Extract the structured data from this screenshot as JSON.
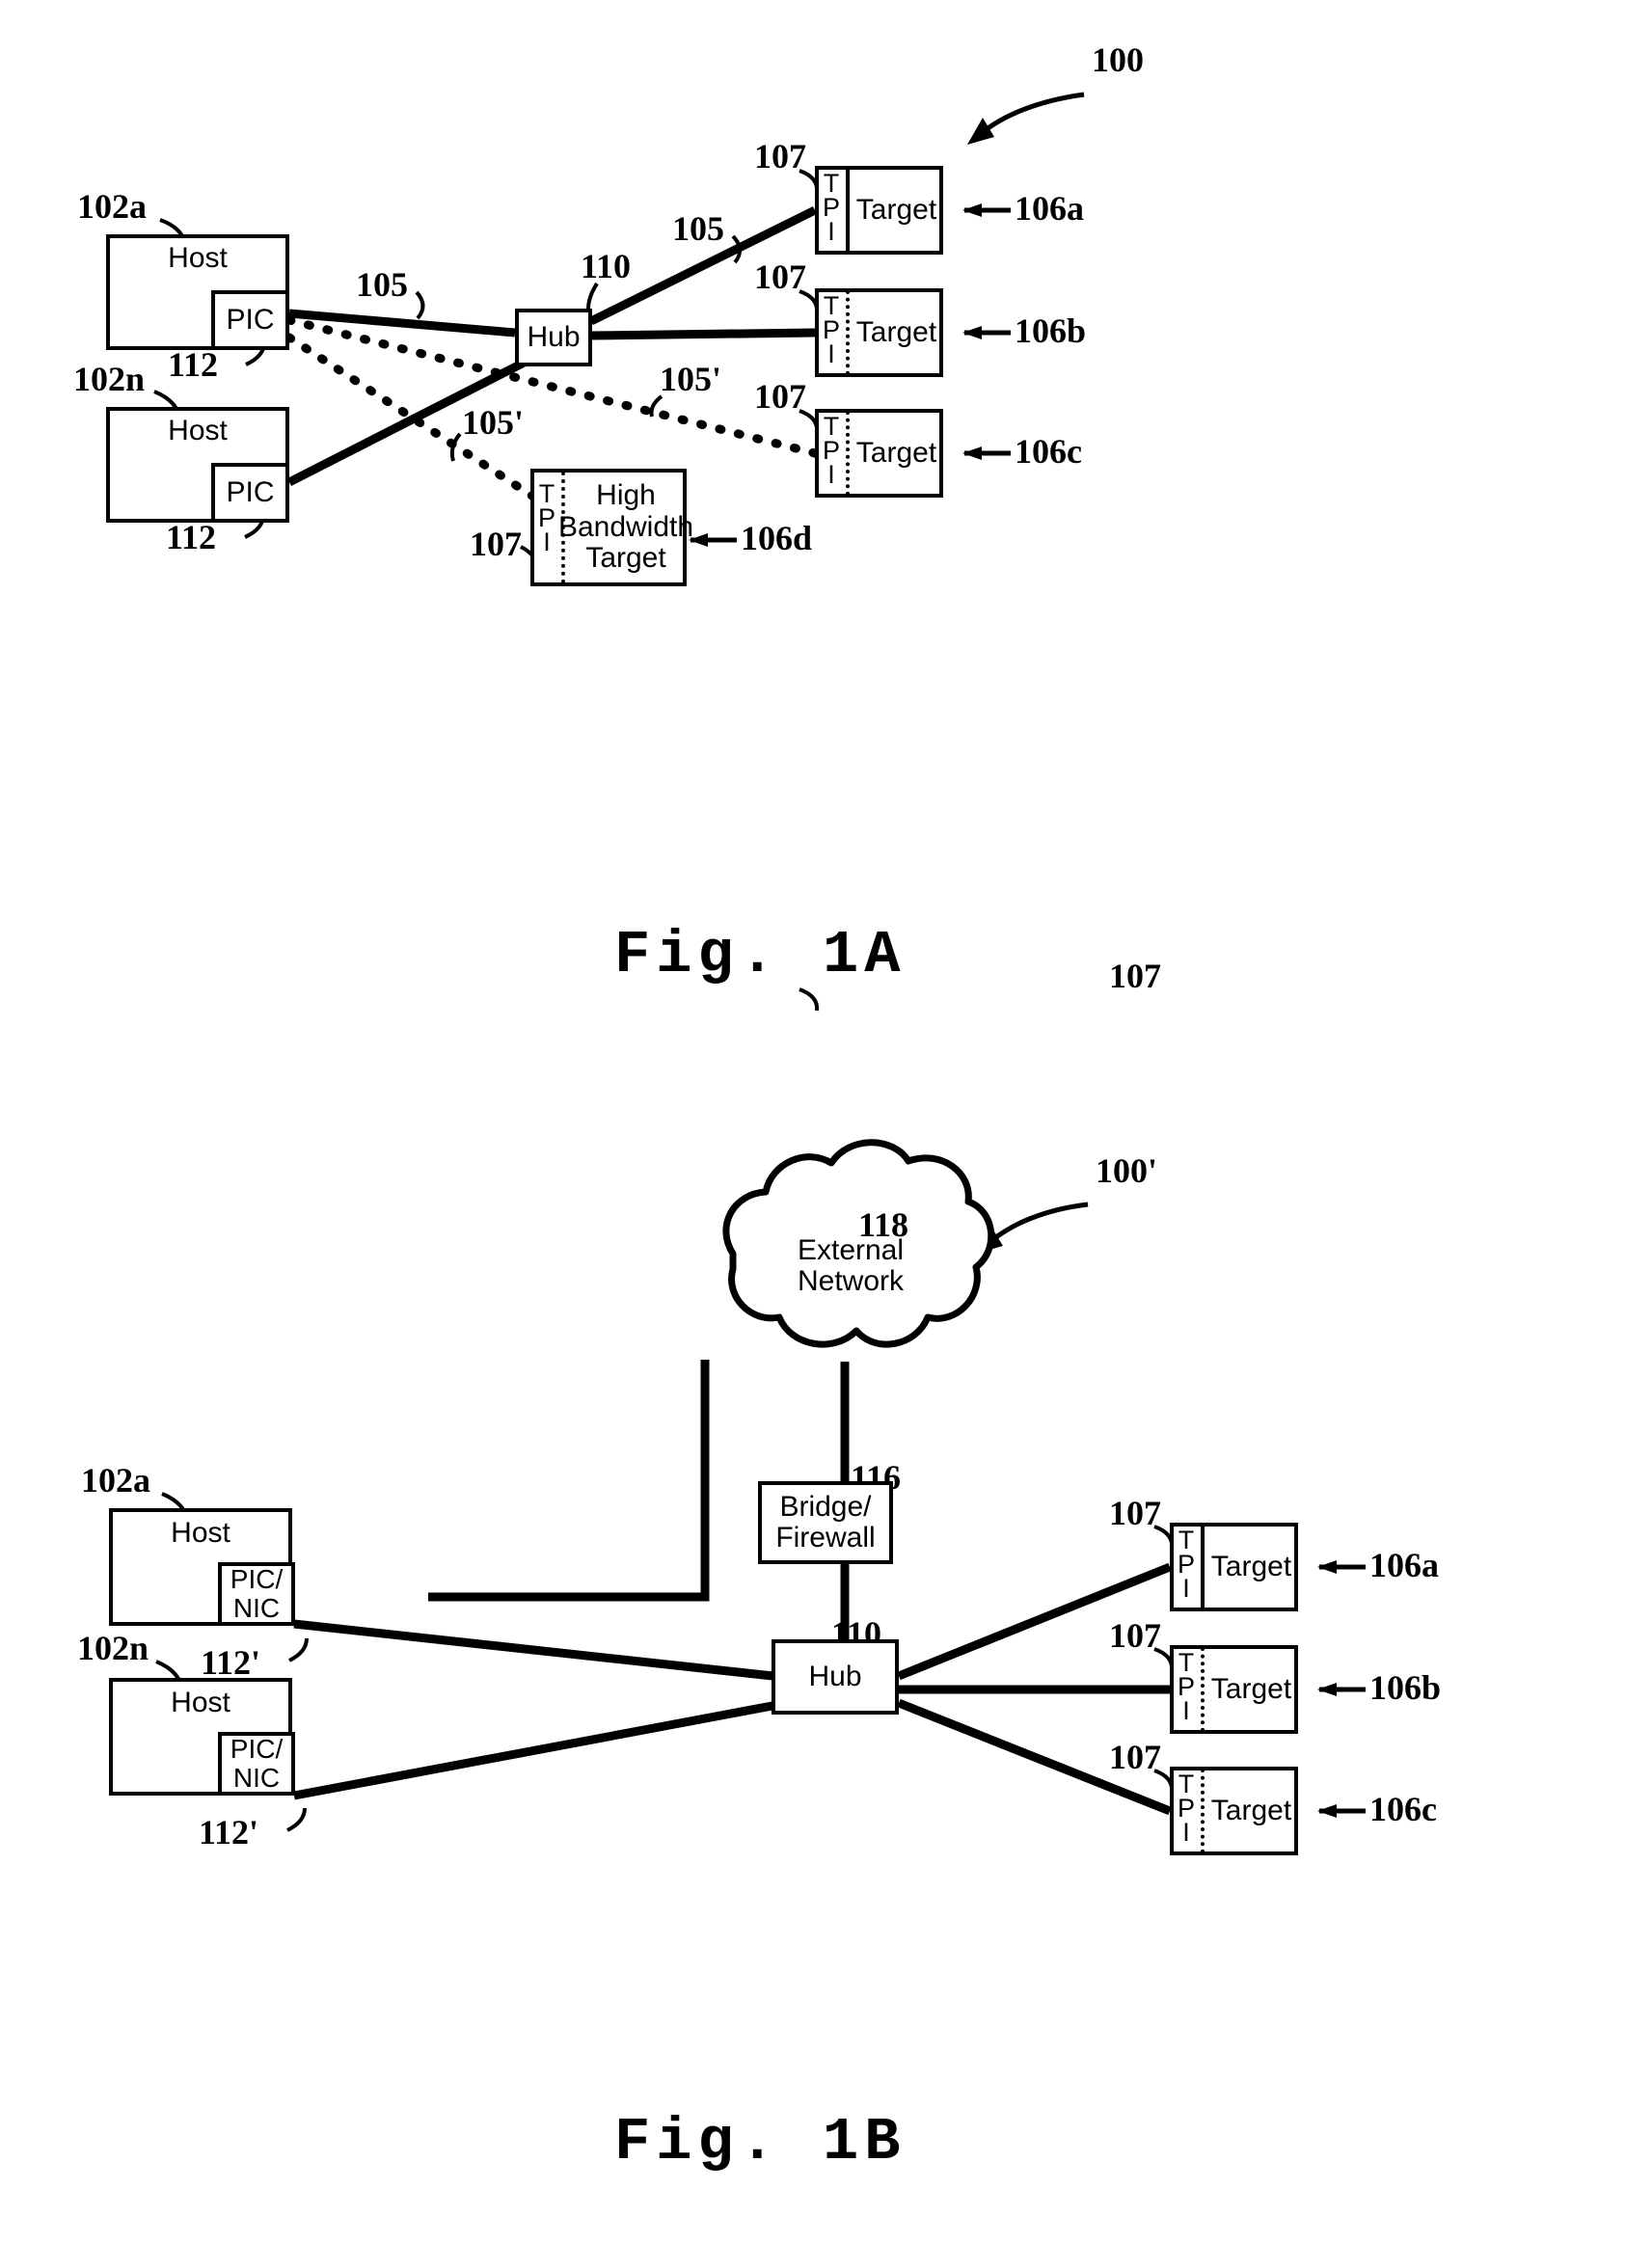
{
  "figures": [
    {
      "id": "fig1a",
      "caption": "Fig. 1A",
      "system_ref": "100",
      "hosts": [
        {
          "ref": "102a",
          "label": "Host",
          "adapter_label": "PIC",
          "adapter_ref": "112"
        },
        {
          "ref": "102n",
          "label": "Host",
          "adapter_label": "PIC",
          "adapter_ref": "112"
        }
      ],
      "hub": {
        "label": "Hub",
        "ref": "110"
      },
      "targets": [
        {
          "ref": "106a",
          "label": "Target",
          "tpi": "TPI",
          "tpi_ref": "107",
          "divider": "solid"
        },
        {
          "ref": "106b",
          "label": "Target",
          "tpi": "TPI",
          "tpi_ref": "107",
          "divider": "dotted"
        },
        {
          "ref": "106c",
          "label": "Target",
          "tpi": "TPI",
          "tpi_ref": "107",
          "divider": "dotted"
        },
        {
          "ref": "106d",
          "label": "High\nBandwidth\nTarget",
          "tpi": "TPI",
          "tpi_ref": "107",
          "divider": "dotted"
        }
      ],
      "link_refs_solid": [
        "105",
        "105"
      ],
      "link_refs_dotted": [
        "105'",
        "105'"
      ]
    },
    {
      "id": "fig1b",
      "caption": "Fig. 1B",
      "system_ref": "100'",
      "cloud": {
        "label": "External\nNetwork",
        "ref": "118"
      },
      "bridge": {
        "label": "Bridge/\nFirewall",
        "ref": "116"
      },
      "hub": {
        "label": "Hub",
        "ref": "110"
      },
      "hosts": [
        {
          "ref": "102a",
          "label": "Host",
          "adapter_label": "PIC/\nNIC",
          "adapter_ref": "112'"
        },
        {
          "ref": "102n",
          "label": "Host",
          "adapter_label": "PIC/\nNIC",
          "adapter_ref": "112'"
        }
      ],
      "targets": [
        {
          "ref": "106a",
          "label": "Target",
          "tpi": "TPI",
          "tpi_ref": "107",
          "divider": "solid"
        },
        {
          "ref": "106b",
          "label": "Target",
          "tpi": "TPI",
          "tpi_ref": "107",
          "divider": "dotted"
        },
        {
          "ref": "106c",
          "label": "Target",
          "tpi": "TPI",
          "tpi_ref": "107",
          "divider": "dotted"
        }
      ]
    }
  ],
  "fig1a": {
    "caption": "Fig. 1A",
    "system_ref": "100",
    "host_a_ref": "102a",
    "host_a_label": "Host",
    "host_a_pic": "PIC",
    "host_a_pic_ref": "112",
    "host_n_ref": "102n",
    "host_n_label": "Host",
    "host_n_pic": "PIC",
    "host_n_pic_ref": "112",
    "hub_label": "Hub",
    "hub_ref": "110",
    "link_top_ref": "105",
    "link_right_ref": "105",
    "link_dotted_ref_1": "105'",
    "link_dotted_ref_2": "105'",
    "tpi_text": "TPI",
    "tpi_ref_a": "107",
    "tpi_ref_b": "107",
    "tpi_ref_c": "107",
    "tpi_ref_d": "107",
    "target_a_label": "Target",
    "target_a_ref": "106a",
    "target_b_label": "Target",
    "target_b_ref": "106b",
    "target_c_label": "Target",
    "target_c_ref": "106c",
    "target_d_label": "High\nBandwidth\nTarget",
    "target_d_ref": "106d"
  },
  "fig1b": {
    "caption": "Fig. 1B",
    "system_ref": "100'",
    "cloud_label": "External\nNetwork",
    "cloud_ref": "118",
    "bridge_label": "Bridge/\nFirewall",
    "bridge_ref": "116",
    "hub_label": "Hub",
    "hub_ref": "110",
    "host_a_ref": "102a",
    "host_a_label": "Host",
    "host_a_pic": "PIC/\nNIC",
    "host_a_pic_ref": "112'",
    "host_n_ref": "102n",
    "host_n_label": "Host",
    "host_n_pic": "PIC/\nNIC",
    "host_n_pic_ref": "112'",
    "tpi_text": "TPI",
    "tpi_ref_a": "107",
    "tpi_ref_b": "107",
    "tpi_ref_c": "107",
    "target_a_label": "Target",
    "target_a_ref": "106a",
    "target_b_label": "Target",
    "target_b_ref": "106b",
    "target_c_label": "Target",
    "target_c_ref": "106c"
  },
  "colors": {
    "ink": "#000000",
    "paper": "#ffffff"
  }
}
